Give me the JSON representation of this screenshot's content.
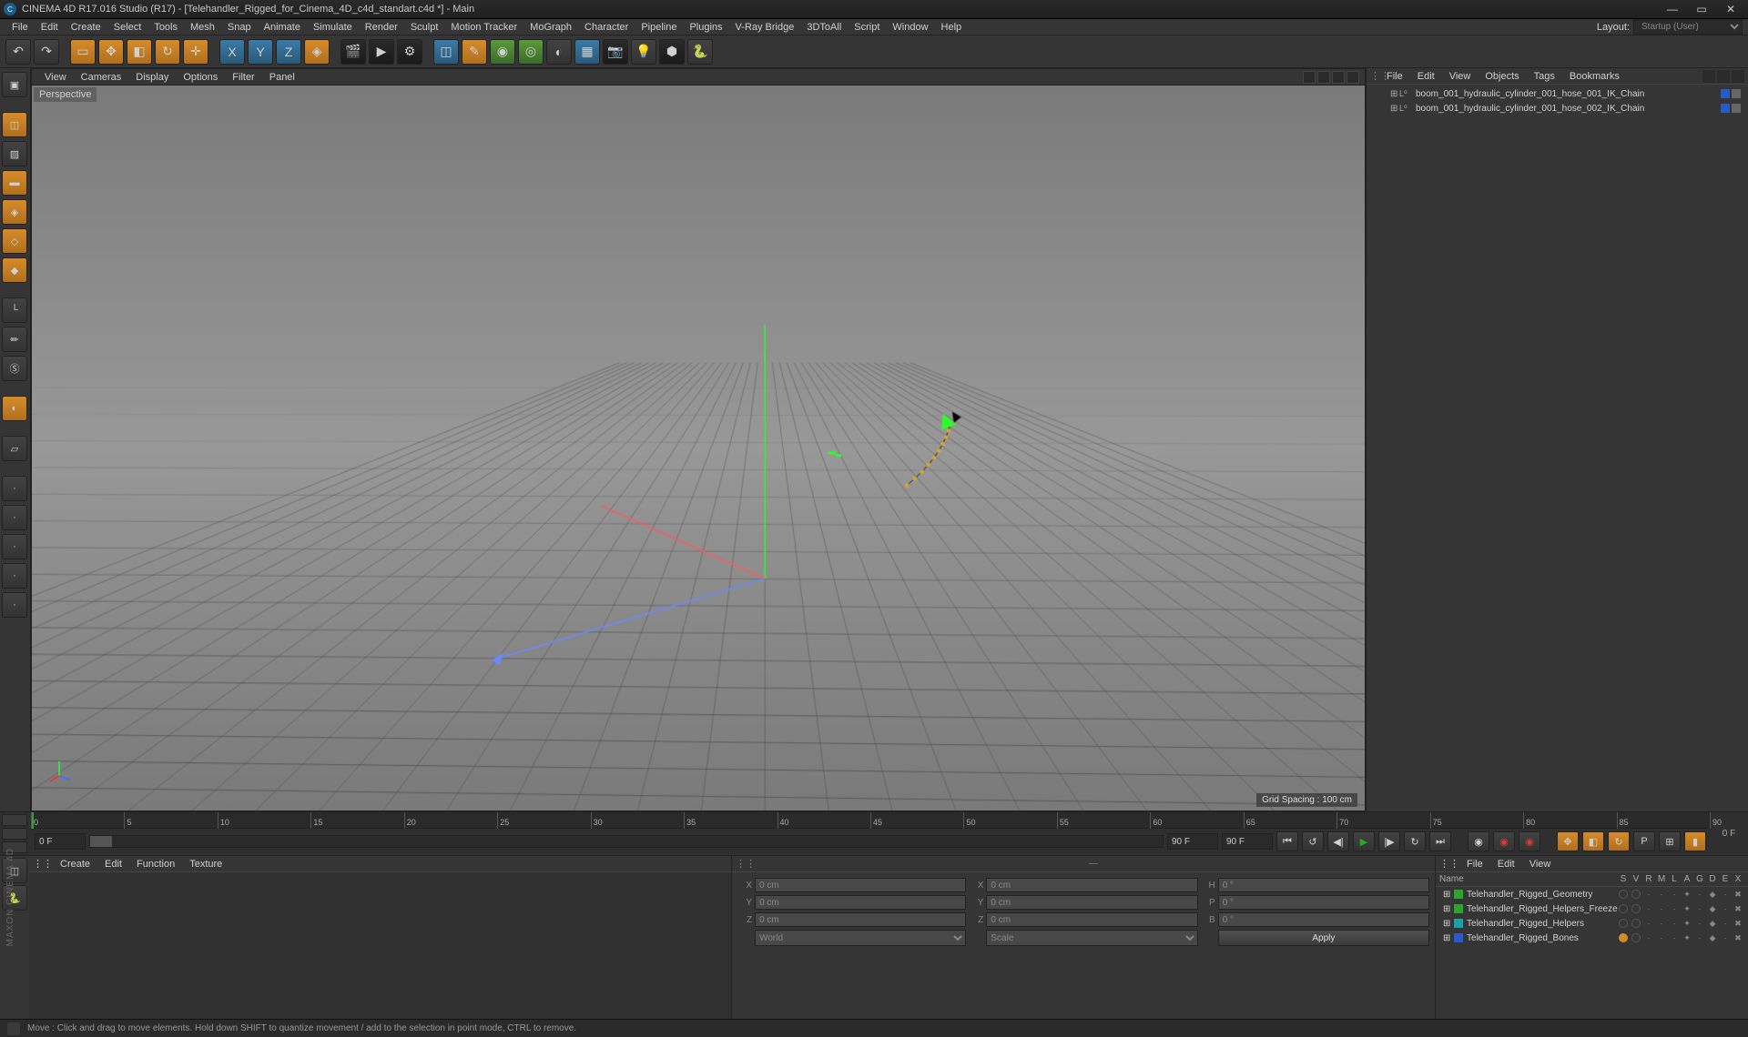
{
  "titlebar": {
    "title": "CINEMA 4D R17.016 Studio (R17) - [Telehandler_Rigged_for_Cinema_4D_c4d_standart.c4d *] - Main"
  },
  "menubar": {
    "items": [
      "File",
      "Edit",
      "Create",
      "Select",
      "Tools",
      "Mesh",
      "Snap",
      "Animate",
      "Simulate",
      "Render",
      "Sculpt",
      "Motion Tracker",
      "MoGraph",
      "Character",
      "Pipeline",
      "Plugins",
      "V-Ray Bridge",
      "3DToAll",
      "Script",
      "Window",
      "Help"
    ],
    "layout_label": "Layout:",
    "layout_value": "Startup (User)"
  },
  "viewport": {
    "menu": [
      "View",
      "Cameras",
      "Display",
      "Options",
      "Filter",
      "Panel"
    ],
    "label": "Perspective",
    "grid_label": "Grid Spacing : 100 cm"
  },
  "object_manager": {
    "menu": [
      "File",
      "Edit",
      "View",
      "Objects",
      "Tags",
      "Bookmarks"
    ],
    "items": [
      {
        "name": "boom_001_hydraulic_cylinder_001_hose_001_IK_Chain"
      },
      {
        "name": "boom_001_hydraulic_cylinder_001_hose_002_IK_Chain"
      }
    ]
  },
  "timeline": {
    "ticks": [
      0,
      5,
      10,
      15,
      20,
      25,
      30,
      35,
      40,
      45,
      50,
      55,
      60,
      65,
      70,
      75,
      80,
      85,
      90
    ],
    "end_label": "0 F",
    "frame_start": "0 F",
    "frame_cur": "0 F",
    "frame_end": "90 F",
    "frame_total": "90 F"
  },
  "material_manager": {
    "menu": [
      "Create",
      "Edit",
      "Function",
      "Texture"
    ]
  },
  "coords": {
    "x_label": "X",
    "x_val": "0 cm",
    "sx_label": "X",
    "sx_val": "0 cm",
    "h_label": "H",
    "h_val": "0 °",
    "y_label": "Y",
    "y_val": "0 cm",
    "sy_label": "Y",
    "sy_val": "0 cm",
    "p_label": "P",
    "p_val": "0 °",
    "z_label": "Z",
    "z_val": "0 cm",
    "sz_label": "Z",
    "sz_val": "0 cm",
    "b_label": "B",
    "b_val": "0 °",
    "mode1": "World",
    "mode2": "Scale",
    "apply": "Apply"
  },
  "attributes": {
    "menu": [
      "File",
      "Edit",
      "View"
    ],
    "header_name": "Name",
    "header_cols": [
      "S",
      "V",
      "R",
      "M",
      "L",
      "A",
      "G",
      "D",
      "E",
      "X"
    ],
    "rows": [
      {
        "color": "#2aa62a",
        "name": "Telehandler_Rigged_Geometry"
      },
      {
        "color": "#2aa62a",
        "name": "Telehandler_Rigged_Helpers_Freeze"
      },
      {
        "color": "#1aa0a8",
        "name": "Telehandler_Rigged_Helpers"
      },
      {
        "color": "#2a5ac8",
        "name": "Telehandler_Rigged_Bones"
      }
    ]
  },
  "statusbar": {
    "text": "Move : Click and drag to move elements. Hold down SHIFT to quantize movement / add to the selection in point mode, CTRL to remove."
  },
  "branding": "MAXON  CINEMA 4D"
}
